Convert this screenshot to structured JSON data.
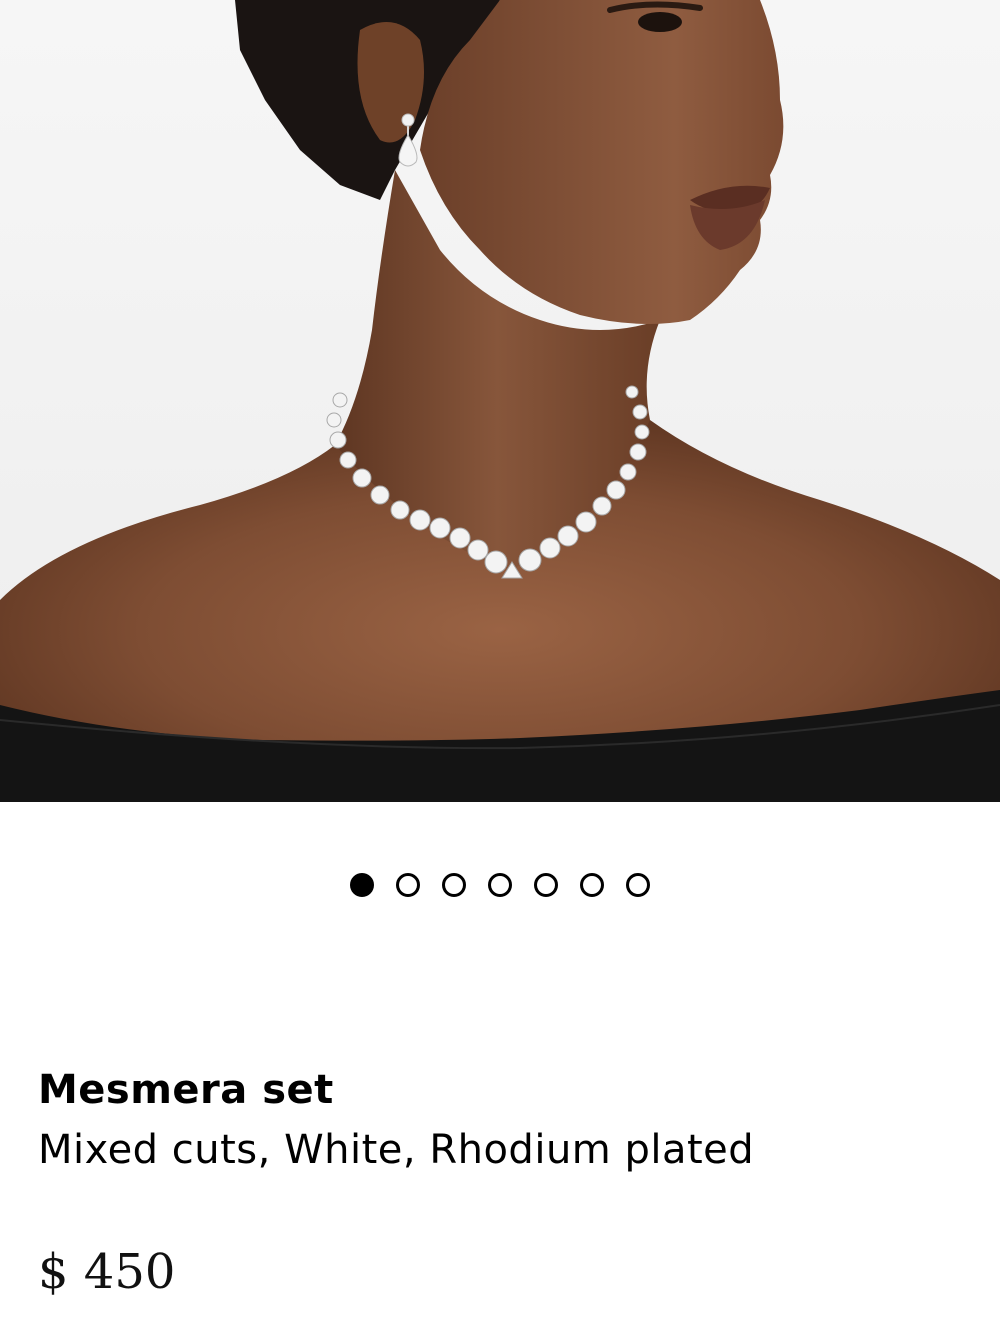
{
  "product": {
    "image_alt": "Model wearing Mesmera necklace and earrings",
    "name": "Mesmera set",
    "description": "Mixed cuts, White, Rhodium plated",
    "price": "$ 450"
  },
  "carousel": {
    "total_slides": 7,
    "active_index": 0
  },
  "colors": {
    "background": "#ffffff",
    "text": "#000000",
    "dot_active": "#000000"
  }
}
